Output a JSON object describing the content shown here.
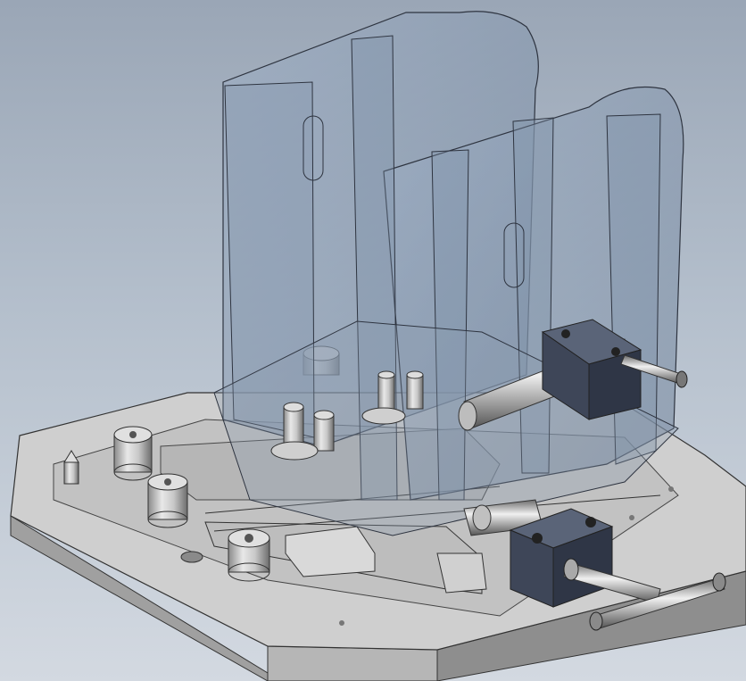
{
  "viewport": {
    "background_top": "#9aa6b6",
    "background_bottom": "#d3d9e1"
  },
  "model": {
    "plate_color": "#c4c4c4",
    "plate_top_color": "#d2d2d2",
    "plate_side_color": "#9c9c9c",
    "glass_color": "#8a9bb0",
    "glass_edge_color": "#2e3440",
    "clamp_block_color": "#3e4658",
    "steel_color": "#b8b8b8"
  },
  "components": [
    "base-plate",
    "transparent-enclosure",
    "clamp-block-right",
    "clamp-block-front",
    "t-handle",
    "cylindrical-standoffs",
    "locating-pin",
    "slide-rails",
    "threaded-rod"
  ]
}
